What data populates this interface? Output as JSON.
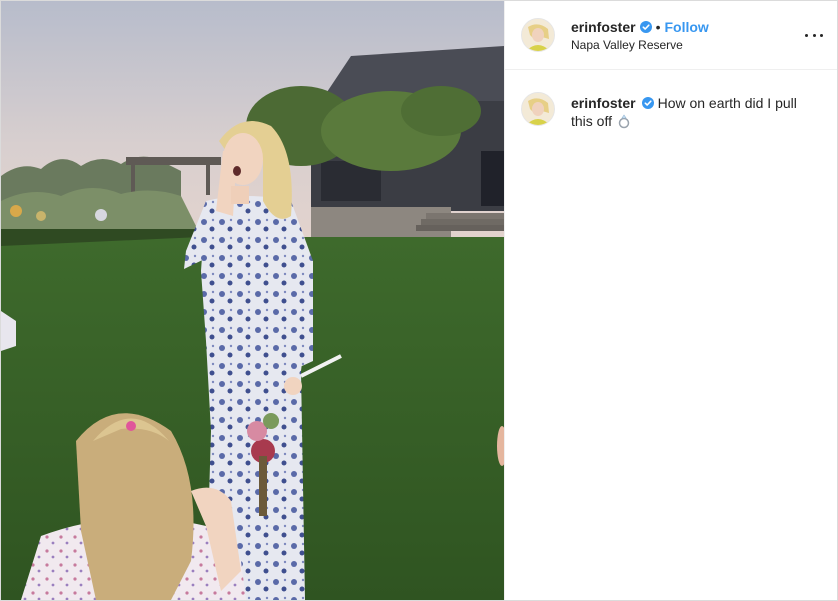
{
  "post": {
    "username": "erinfoster",
    "separator": "•",
    "follow_label": "Follow",
    "location": "Napa Valley Reserve",
    "caption": "How on earth did I pull this off",
    "caption_emoji": "ring-icon"
  },
  "colors": {
    "follow_blue": "#3897f0",
    "verified_blue": "#3897f0",
    "text": "#262626",
    "divider": "#efefef"
  }
}
